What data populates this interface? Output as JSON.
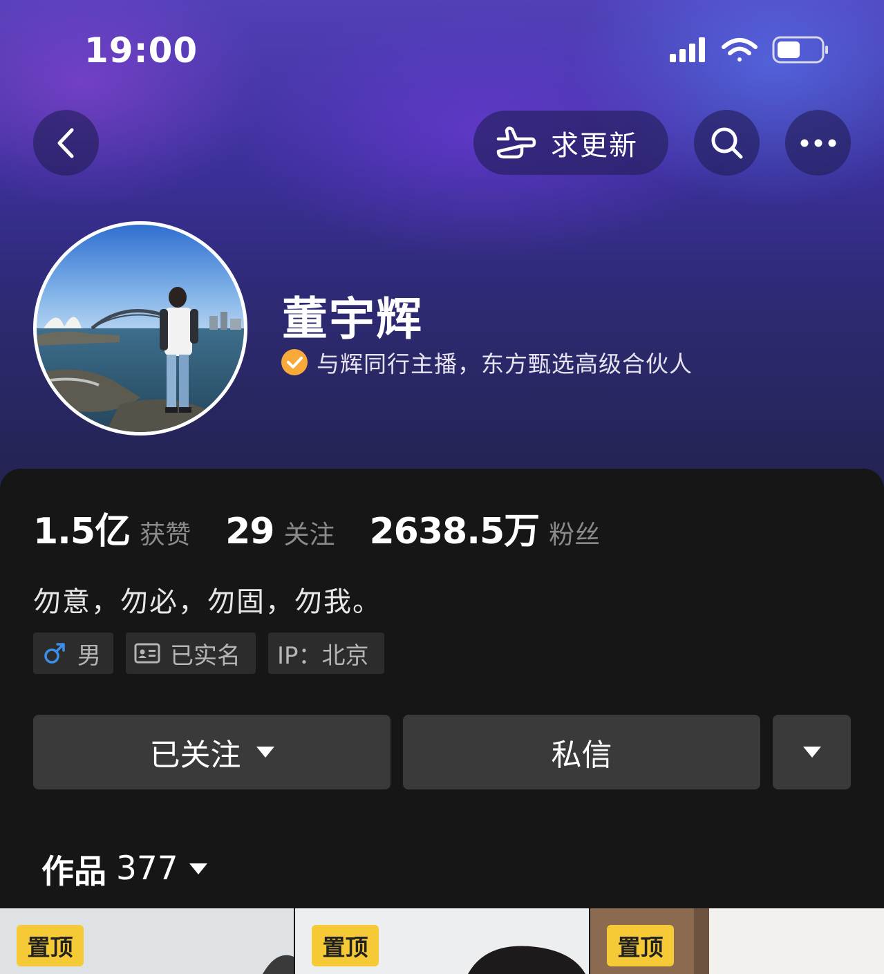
{
  "status_bar": {
    "time": "19:00"
  },
  "nav": {
    "request_update_label": "求更新"
  },
  "profile": {
    "name": "董宇辉",
    "verification": "与辉同行主播，东方甄选高级合伙人"
  },
  "stats": [
    {
      "value": "1.5亿",
      "label": "获赞"
    },
    {
      "value": "29",
      "label": "关注"
    },
    {
      "value": "2638.5万",
      "label": "粉丝"
    }
  ],
  "bio": "勿意，勿必，勿固，勿我。",
  "tags": {
    "gender": "男",
    "real_name": "已实名",
    "ip": "IP：北京"
  },
  "actions": {
    "followed": "已关注",
    "message": "私信"
  },
  "works": {
    "label": "作品",
    "count": "377"
  },
  "thumbnails": [
    {
      "pin": "置顶"
    },
    {
      "pin": "置顶"
    },
    {
      "pin": "置顶"
    }
  ],
  "colors": {
    "panel_bg": "#161616",
    "button_bg": "#3a3a3a",
    "pin_badge": "#f6c937",
    "verify_badge": "#f7a93a",
    "gender_icon": "#3d8eea"
  }
}
